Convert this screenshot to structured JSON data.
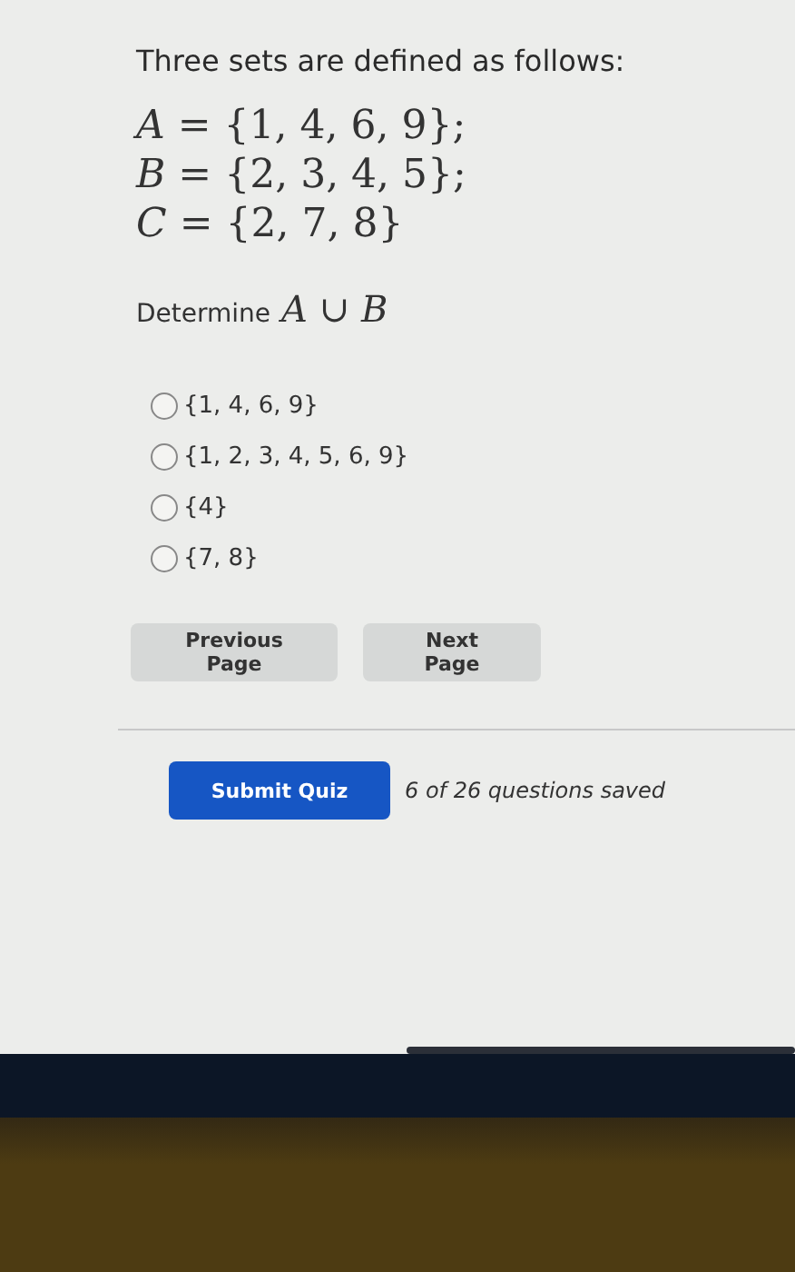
{
  "question": {
    "intro": "Three sets are defined as follows:",
    "definitions": [
      "*A* = {1, 4, 6, 9};",
      "*B* = {2, 3, 4, 5};",
      "*C* = {2, 7, 8}"
    ],
    "prompt": "Determine",
    "prompt_math": "*A* ∪ *B*"
  },
  "options": [
    {
      "label": "{1, 4, 6, 9}",
      "selected": false
    },
    {
      "label": "{1, 2, 3, 4, 5, 6, 9}",
      "selected": false
    },
    {
      "label": "{4}",
      "selected": false
    },
    {
      "label": "{7, 8}",
      "selected": false
    }
  ],
  "navigation": [
    "Previous Page",
    "Next Page"
  ],
  "submit": {
    "label": "Submit Quiz",
    "status": "6 of 26 questions saved"
  }
}
